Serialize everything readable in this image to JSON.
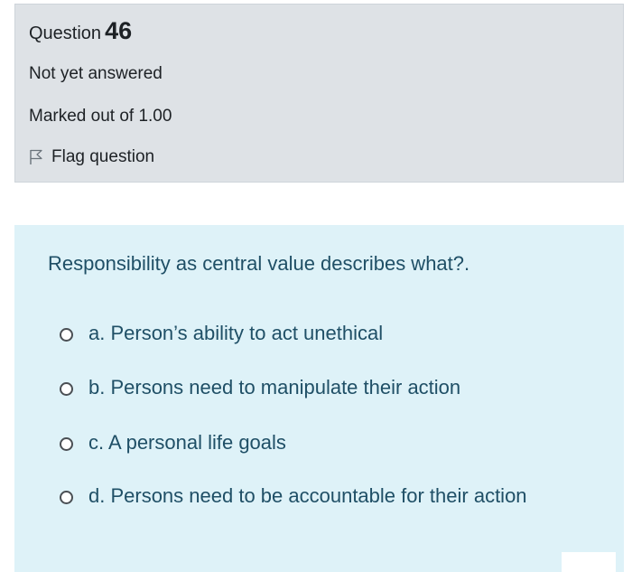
{
  "question": {
    "label": "Question",
    "number": "46",
    "state": "Not yet answered",
    "grade": "Marked out of 1.00",
    "flag_label": "Flag question",
    "text": "Responsibility as central value describes what?."
  },
  "answers": [
    {
      "text": "a. Person’s ability to act unethical",
      "selected": false
    },
    {
      "text": "b. Persons need to manipulate their action",
      "selected": false
    },
    {
      "text": "c. A personal life goals",
      "selected": false
    },
    {
      "text": "d. Persons need to be accountable for their action",
      "selected": false
    }
  ],
  "colors": {
    "info_bg": "#dee2e6",
    "content_bg": "#def2f8",
    "question_text": "#1f4f66"
  },
  "icons": {
    "flag": "flag-icon",
    "radio": "radio-unchecked-icon"
  }
}
